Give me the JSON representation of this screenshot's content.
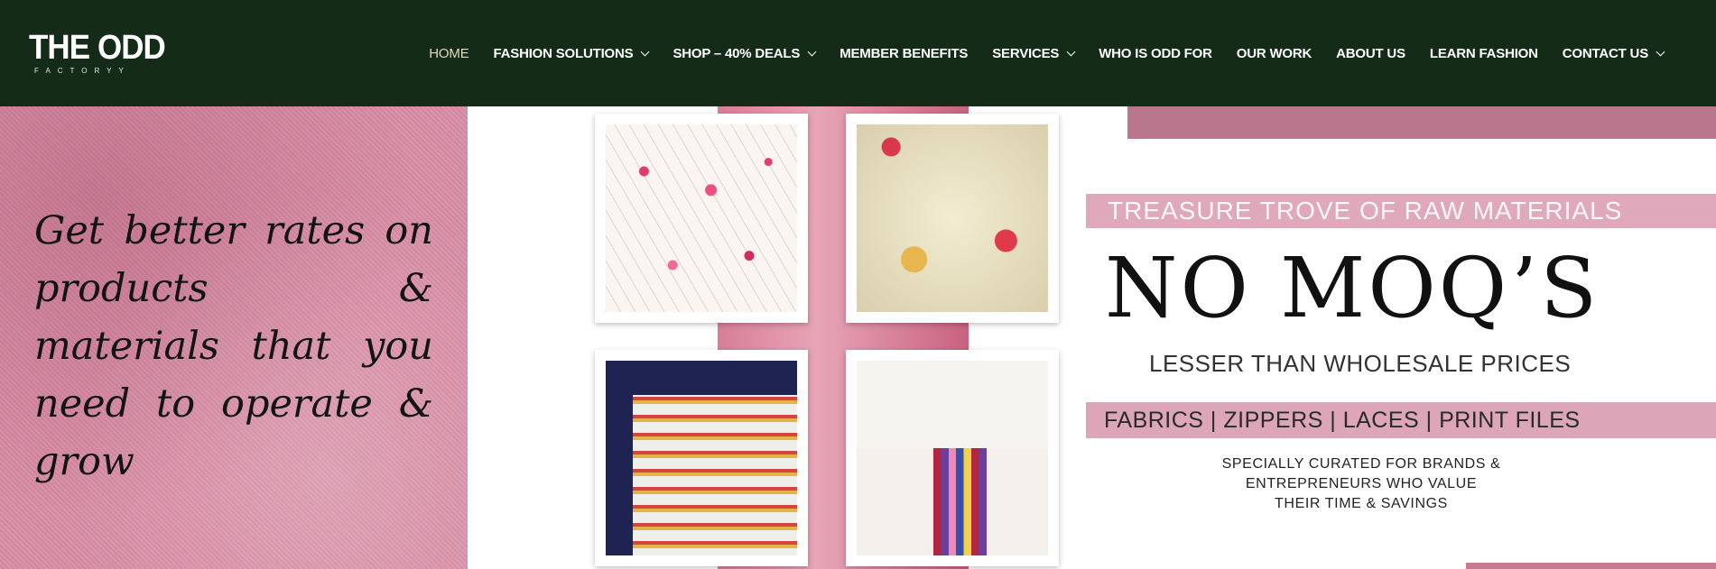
{
  "header": {
    "logo_main": "THE ODD",
    "logo_sub": "FACTORYY",
    "nav": [
      {
        "label": "HOME",
        "dropdown": false,
        "active": true
      },
      {
        "label": "FASHION SOLUTIONS",
        "dropdown": true
      },
      {
        "label": "SHOP – 40% DEALS",
        "dropdown": true
      },
      {
        "label": "MEMBER BENEFITS",
        "dropdown": false
      },
      {
        "label": "SERVICES",
        "dropdown": true
      },
      {
        "label": "WHO IS ODD FOR",
        "dropdown": false
      },
      {
        "label": "OUR WORK",
        "dropdown": false
      },
      {
        "label": "ABOUT US",
        "dropdown": false
      },
      {
        "label": "LEARN FASHION",
        "dropdown": false
      },
      {
        "label": "CONTACT US",
        "dropdown": true
      }
    ]
  },
  "hero": {
    "left_text": "Get better rates on products & materials that you need to operate & grow",
    "band_top": "TREASURE TROVE OF RAW MATERIALS",
    "headline": "NO MOQ’S",
    "subheadline": "LESSER THAN WHOLESALE PRICES",
    "band_bottom": "FABRICS | ZIPPERS | LACES | PRINT FILES",
    "tagline_1": "SPECIALLY CURATED FOR BRANDS &",
    "tagline_2": "ENTREPRENEURS WHO VALUE",
    "tagline_3": "THEIR TIME & SAVINGS"
  },
  "colors": {
    "header_bg": "#142b18",
    "accent_pink": "#dfa9bb",
    "active_nav": "#e6d9b8"
  }
}
